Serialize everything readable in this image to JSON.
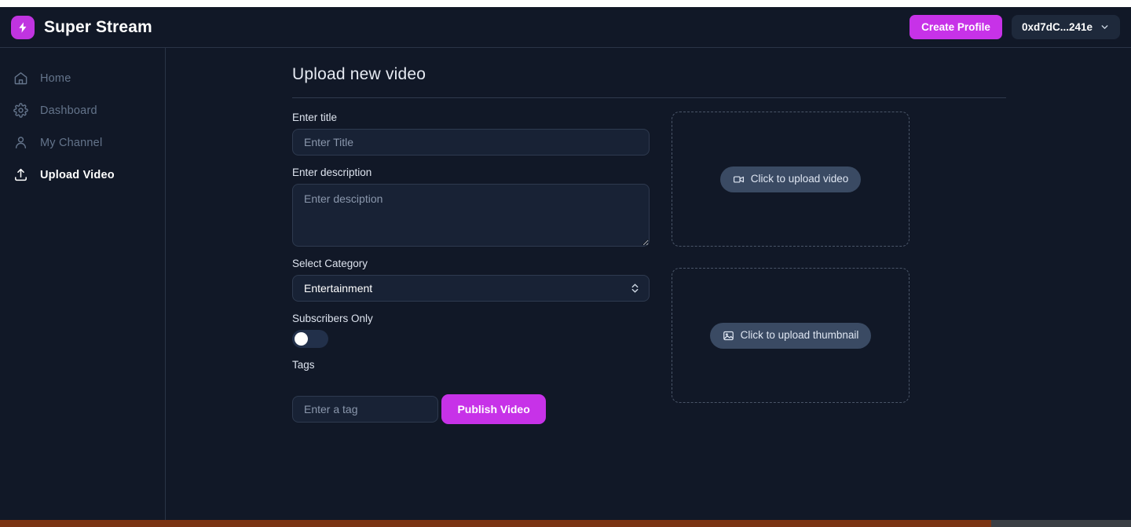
{
  "header": {
    "brand_name": "Super Stream",
    "logo_icon": "lightning-bolt-icon",
    "create_profile_label": "Create Profile",
    "wallet_address": "0xd7dC...241e",
    "wallet_chevron_icon": "chevron-down-icon"
  },
  "sidebar": {
    "items": [
      {
        "label": "Home",
        "icon": "home-icon",
        "active": false
      },
      {
        "label": "Dashboard",
        "icon": "gear-icon",
        "active": false
      },
      {
        "label": "My Channel",
        "icon": "user-icon",
        "active": false
      },
      {
        "label": "Upload Video",
        "icon": "upload-icon",
        "active": true
      }
    ]
  },
  "main": {
    "page_title": "Upload new video",
    "form": {
      "title_label": "Enter title",
      "title_placeholder": "Enter Title",
      "title_value": "",
      "description_label": "Enter description",
      "description_placeholder": "Enter desciption",
      "description_value": "",
      "category_label": "Select Category",
      "category_selected": "Entertainment",
      "category_options": [
        "Entertainment"
      ],
      "category_arrows_icon": "chevron-up-down-icon",
      "subscribers_label": "Subscribers Only",
      "subscribers_enabled": false,
      "tags_label": "Tags",
      "tags_placeholder": "Enter a tag",
      "tags_value": "",
      "publish_label": "Publish Video"
    },
    "dropzones": [
      {
        "label": "Click to upload video",
        "icon": "video-camera-icon"
      },
      {
        "label": "Click to upload thumbnail",
        "icon": "image-icon"
      }
    ]
  },
  "colors": {
    "page_bg": "#111827",
    "panel_bg": "#182235",
    "accent_magenta": "#c732e8",
    "logo_purple": "#c034e0",
    "border": "#2a3446",
    "muted_text": "#64748b",
    "placeholder_text": "#8a97ac"
  }
}
